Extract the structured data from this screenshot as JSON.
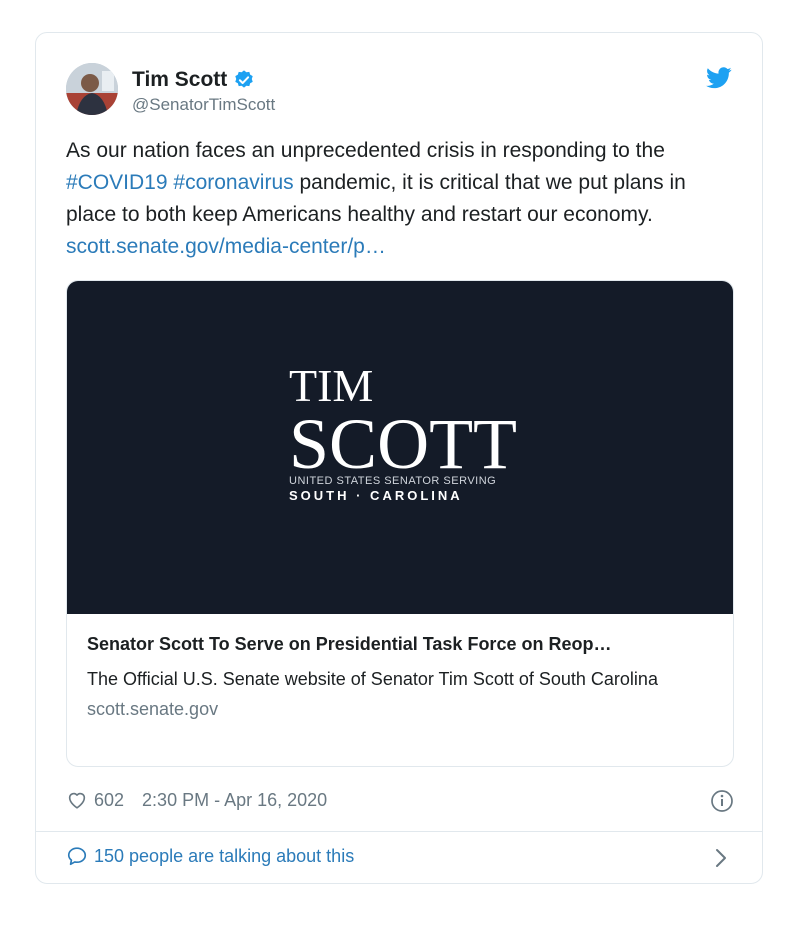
{
  "author": {
    "name": "Tim Scott",
    "handle": "@SenatorTimScott"
  },
  "tweet": {
    "text_part1": "As our nation faces an unprecedented crisis in responding to the ",
    "hashtag1": "#COVID19",
    "space": " ",
    "hashtag2": "#coronavirus",
    "text_part2": " pandemic, it is critical that we put plans in place to both keep Americans healthy and restart our economy. ",
    "link": "scott.senate.gov/media-center/p…"
  },
  "card": {
    "logo_line1": "TIM",
    "logo_line2": "SCOTT",
    "logo_line3": "UNITED STATES SENATOR SERVING",
    "logo_line4": "SOUTH · CAROLINA",
    "title": "Senator Scott To Serve on Presidential Task Force on Reop…",
    "description": "The Official U.S. Senate website of Senator Tim Scott of South Carolina",
    "domain": "scott.senate.gov"
  },
  "meta": {
    "likes": "602",
    "timestamp": "2:30 PM - Apr 16, 2020"
  },
  "conversation": {
    "label": "150 people are talking about this"
  },
  "colors": {
    "link": "#2b7bb9",
    "verified": "#1da1f2",
    "card_background": "#141b28"
  }
}
